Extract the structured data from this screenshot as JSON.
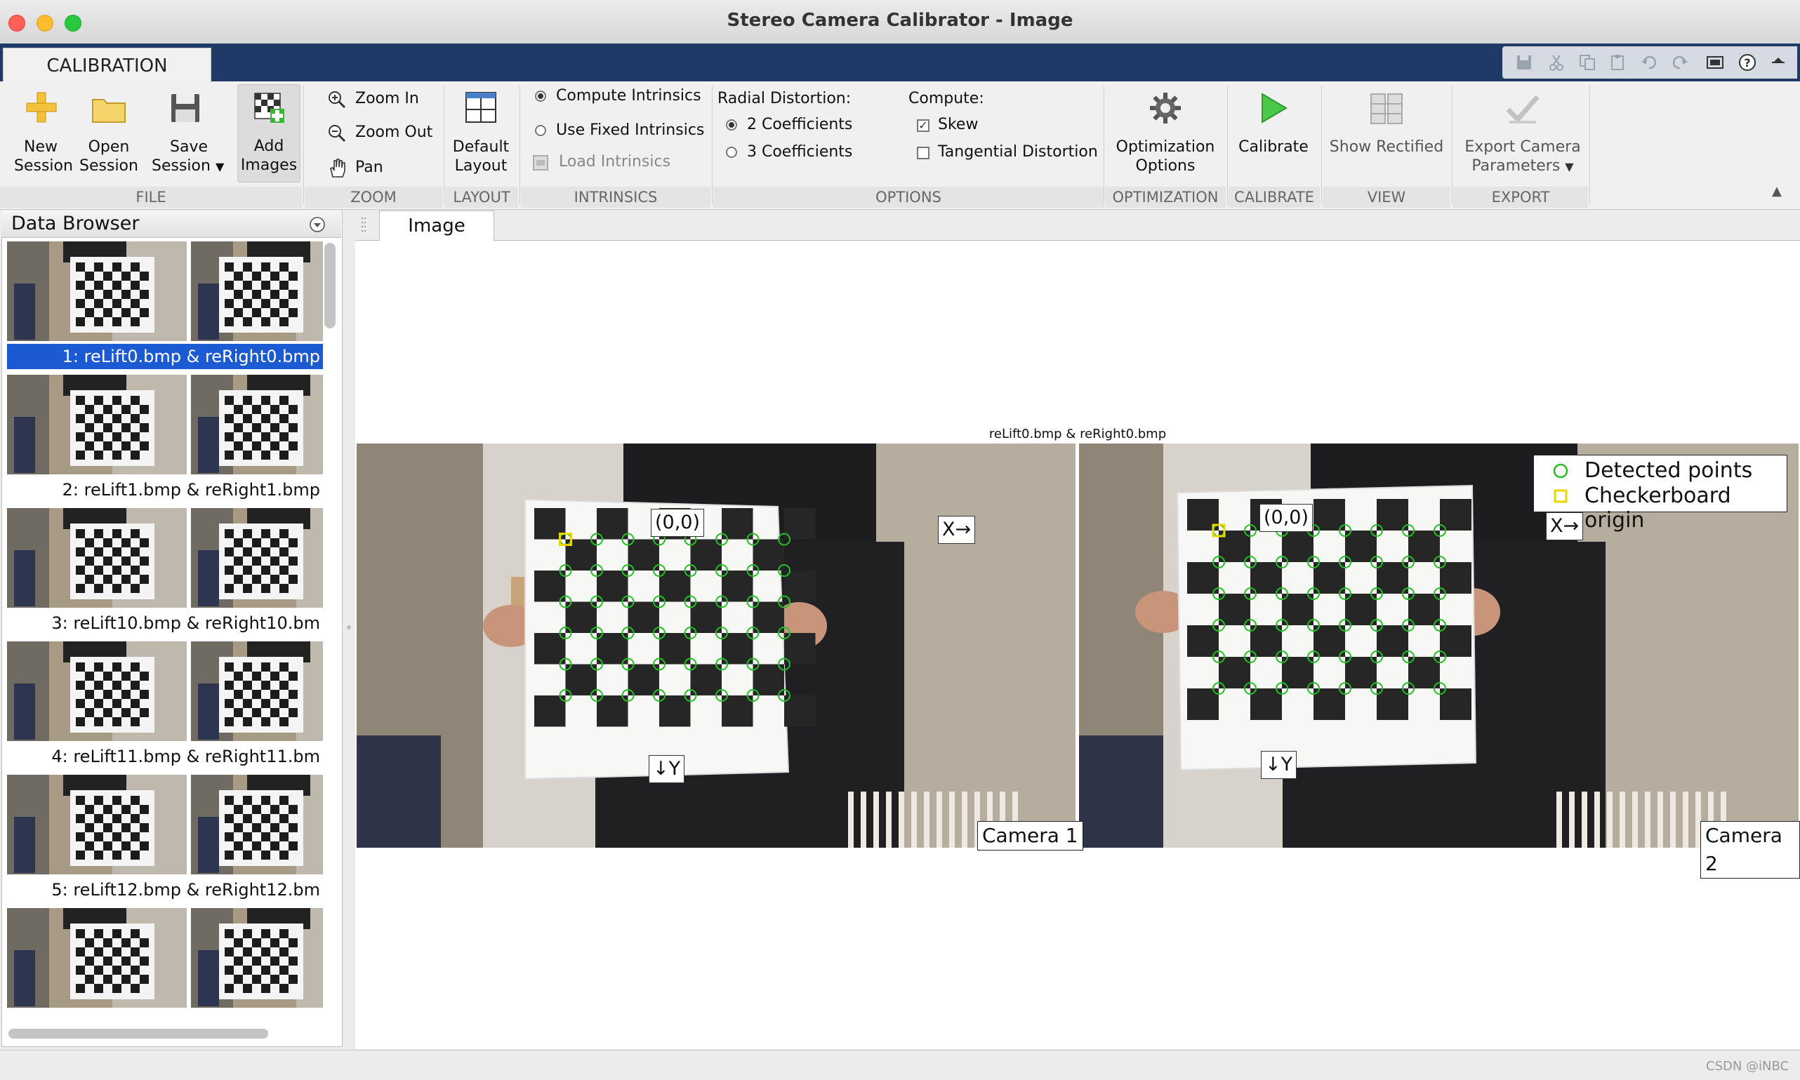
{
  "window": {
    "title": "Stereo Camera Calibrator - Image"
  },
  "ribbon": {
    "tab": "CALIBRATION",
    "file": {
      "new_session": [
        "New",
        "Session"
      ],
      "open_session": [
        "Open",
        "Session"
      ],
      "save_session": [
        "Save",
        "Session"
      ],
      "add_images": [
        "Add",
        "Images"
      ],
      "label": "FILE"
    },
    "zoom": {
      "zoom_in": "Zoom In",
      "zoom_out": "Zoom Out",
      "pan": "Pan",
      "label": "ZOOM"
    },
    "layout": {
      "default_layout": [
        "Default",
        "Layout"
      ],
      "label": "LAYOUT"
    },
    "intrinsics": {
      "compute": "Compute Intrinsics",
      "use_fixed": "Use Fixed Intrinsics",
      "load": "Load Intrinsics",
      "label": "INTRINSICS"
    },
    "options": {
      "radial_title": "Radial Distortion:",
      "two_coeff": "2 Coefficients",
      "three_coeff": "3 Coefficients",
      "compute_title": "Compute:",
      "skew": "Skew",
      "tangential": "Tangential Distortion",
      "label": "OPTIONS"
    },
    "optimization": {
      "button": [
        "Optimization",
        "Options"
      ],
      "label": "OPTIMIZATION"
    },
    "calibrate": {
      "button": "Calibrate",
      "label": "CALIBRATE"
    },
    "view": {
      "button": "Show Rectified",
      "label": "VIEW"
    },
    "export": {
      "button": [
        "Export Camera",
        "Parameters"
      ],
      "label": "EXPORT"
    }
  },
  "data_browser": {
    "title": "Data Browser",
    "items": [
      {
        "label": "1: reLift0.bmp & reRight0.bmp",
        "selected": true
      },
      {
        "label": "2: reLift1.bmp & reRight1.bmp",
        "selected": false
      },
      {
        "label": "3: reLift10.bmp & reRight10.bm",
        "selected": false
      },
      {
        "label": "4: reLift11.bmp & reRight11.bm",
        "selected": false
      },
      {
        "label": "5: reLift12.bmp & reRight12.bm",
        "selected": false
      }
    ]
  },
  "document": {
    "tab": "Image",
    "figure_title": "reLift0.bmp & reRight0.bmp",
    "camera1": "Camera 1",
    "camera2": "Camera 2",
    "origin_label": "(0,0)",
    "x_label": "X→",
    "y_label": "↓Y",
    "legend": {
      "detected": "Detected points",
      "origin": "Checkerboard origin"
    }
  },
  "colors": {
    "ribbon_band": "#1f3a66",
    "selection": "#1c5ad4",
    "detected": "#22c022",
    "origin": "#e8d800"
  },
  "watermark": "CSDN @iNBC"
}
